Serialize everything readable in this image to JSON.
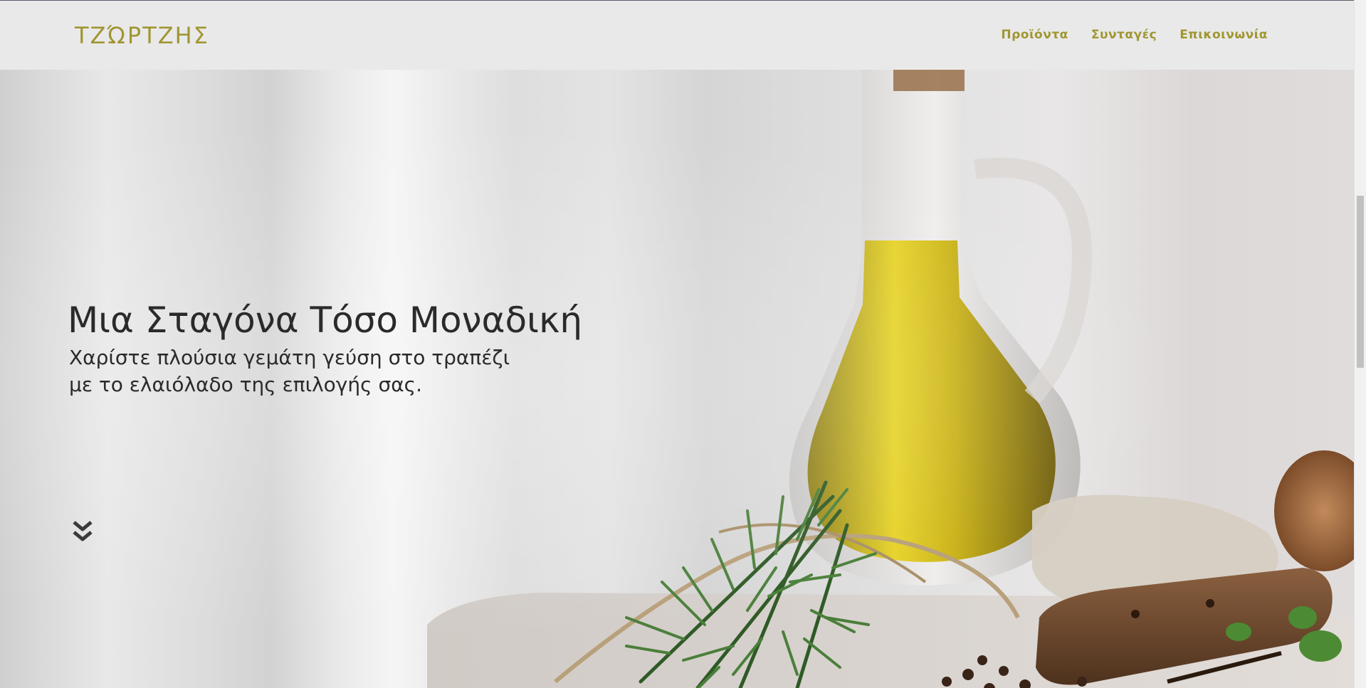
{
  "header": {
    "brand": "ΤΖΏΡΤΖΗΣ",
    "nav": [
      {
        "label": "Προϊόντα"
      },
      {
        "label": "Συνταγές"
      },
      {
        "label": "Επικοινωνία"
      }
    ]
  },
  "hero": {
    "title": "Μια Σταγόνα Τόσο Μοναδική",
    "subtitle_line1": "Χαρίστε πλούσια γεμάτη γεύση στο τραπέζι",
    "subtitle_line2": "με το ελαιόλαδο της επιλογής σας.",
    "scroll_icon": "double-chevron-down-icon"
  },
  "colors": {
    "accent": "#a09631",
    "navbar_bg": "#e9e9e9",
    "text_dark": "#2a2a2a"
  }
}
